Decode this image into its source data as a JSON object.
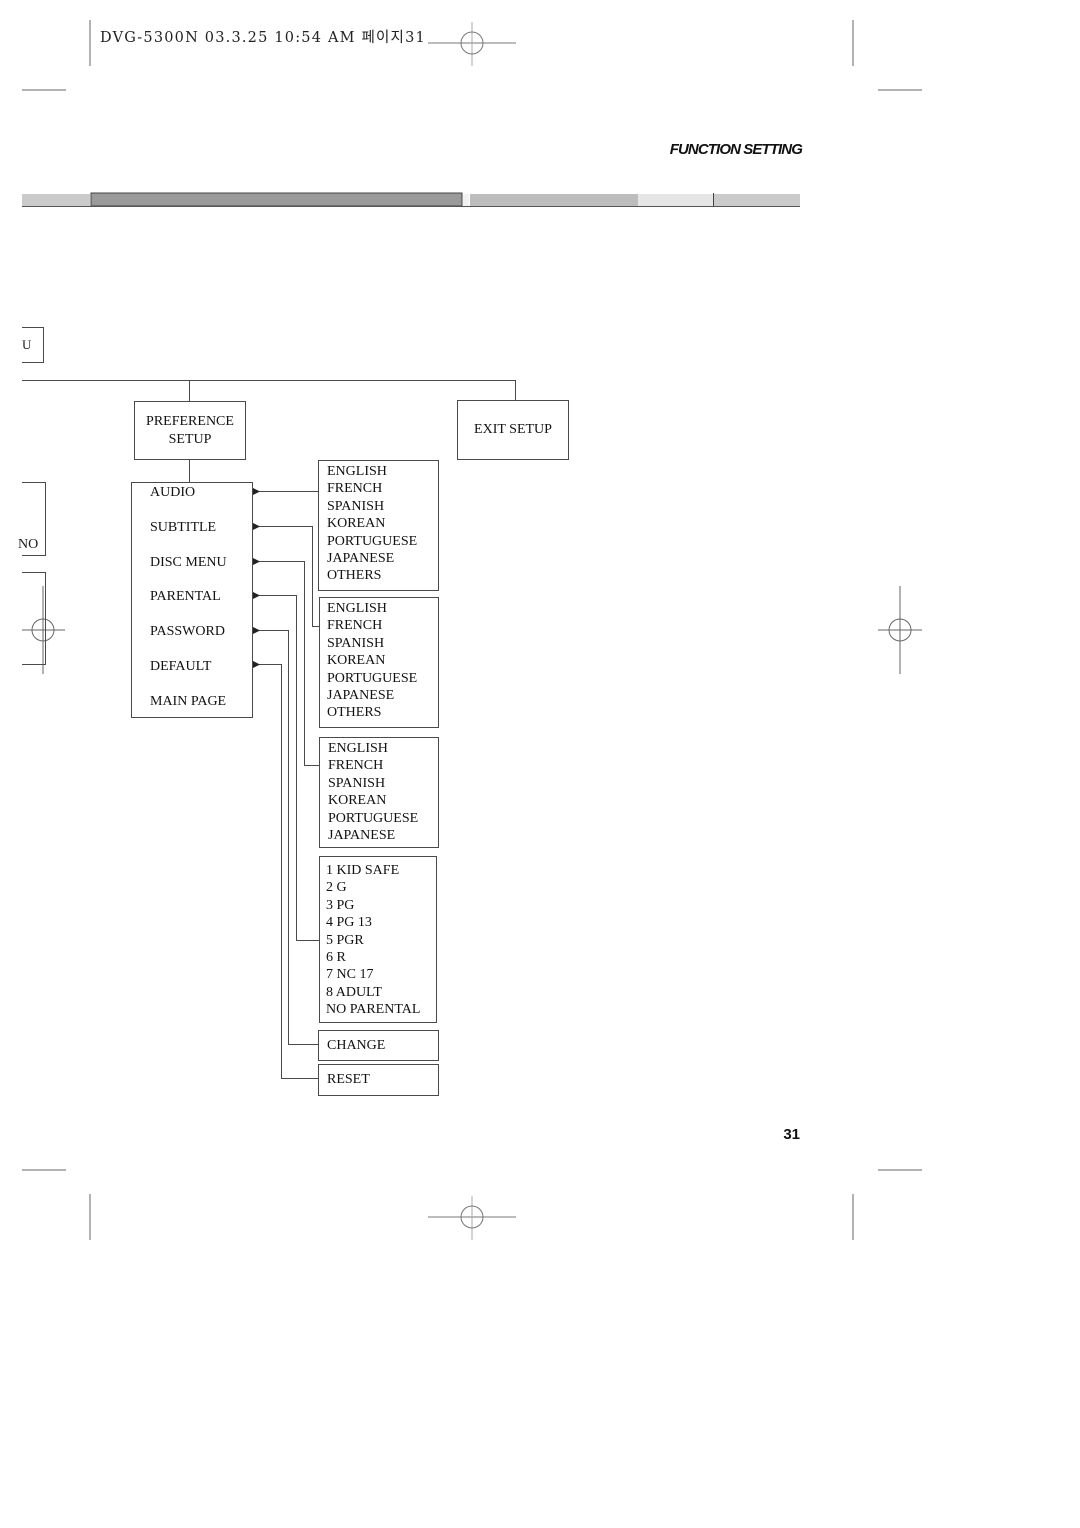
{
  "header": {
    "print_slug": "DVG-5300N  03.3.25 10:54 AM 페이지31"
  },
  "section_title": "FUNCTION SETTING",
  "page_number": "31",
  "colors": {
    "bar_light": "#cbcbcb",
    "bar_dark": "#9a9a9a",
    "bar_mid": "#bdbdbd",
    "bar_pale": "#e6e6e6",
    "line": "#4a4a4a"
  },
  "diagram": {
    "cut_off_left": {
      "top_box_fragment": "U",
      "middle_box_fragment": "NO"
    },
    "preference_setup": {
      "line1": "PREFERENCE",
      "line2": "SETUP"
    },
    "exit_setup": "EXIT SETUP",
    "preference_menu": [
      "AUDIO",
      "SUBTITLE",
      "DISC MENU",
      "PARENTAL",
      "PASSWORD",
      "DEFAULT",
      "MAIN PAGE"
    ],
    "audio_options": [
      "ENGLISH",
      "FRENCH",
      "SPANISH",
      "KOREAN",
      "PORTUGUESE",
      "JAPANESE",
      "OTHERS"
    ],
    "subtitle_options": [
      "ENGLISH",
      "FRENCH",
      "SPANISH",
      "KOREAN",
      "PORTUGUESE",
      "JAPANESE",
      "OTHERS"
    ],
    "disc_menu_options": [
      "ENGLISH",
      "FRENCH",
      "SPANISH",
      "KOREAN",
      "PORTUGUESE",
      "JAPANESE"
    ],
    "parental_options": [
      "1 KID SAFE",
      "2 G",
      "3 PG",
      "4 PG 13",
      "5 PGR",
      "6 R",
      "7 NC 17",
      "8 ADULT",
      "NO PARENTAL"
    ],
    "password_option": "CHANGE",
    "default_option": "RESET"
  }
}
